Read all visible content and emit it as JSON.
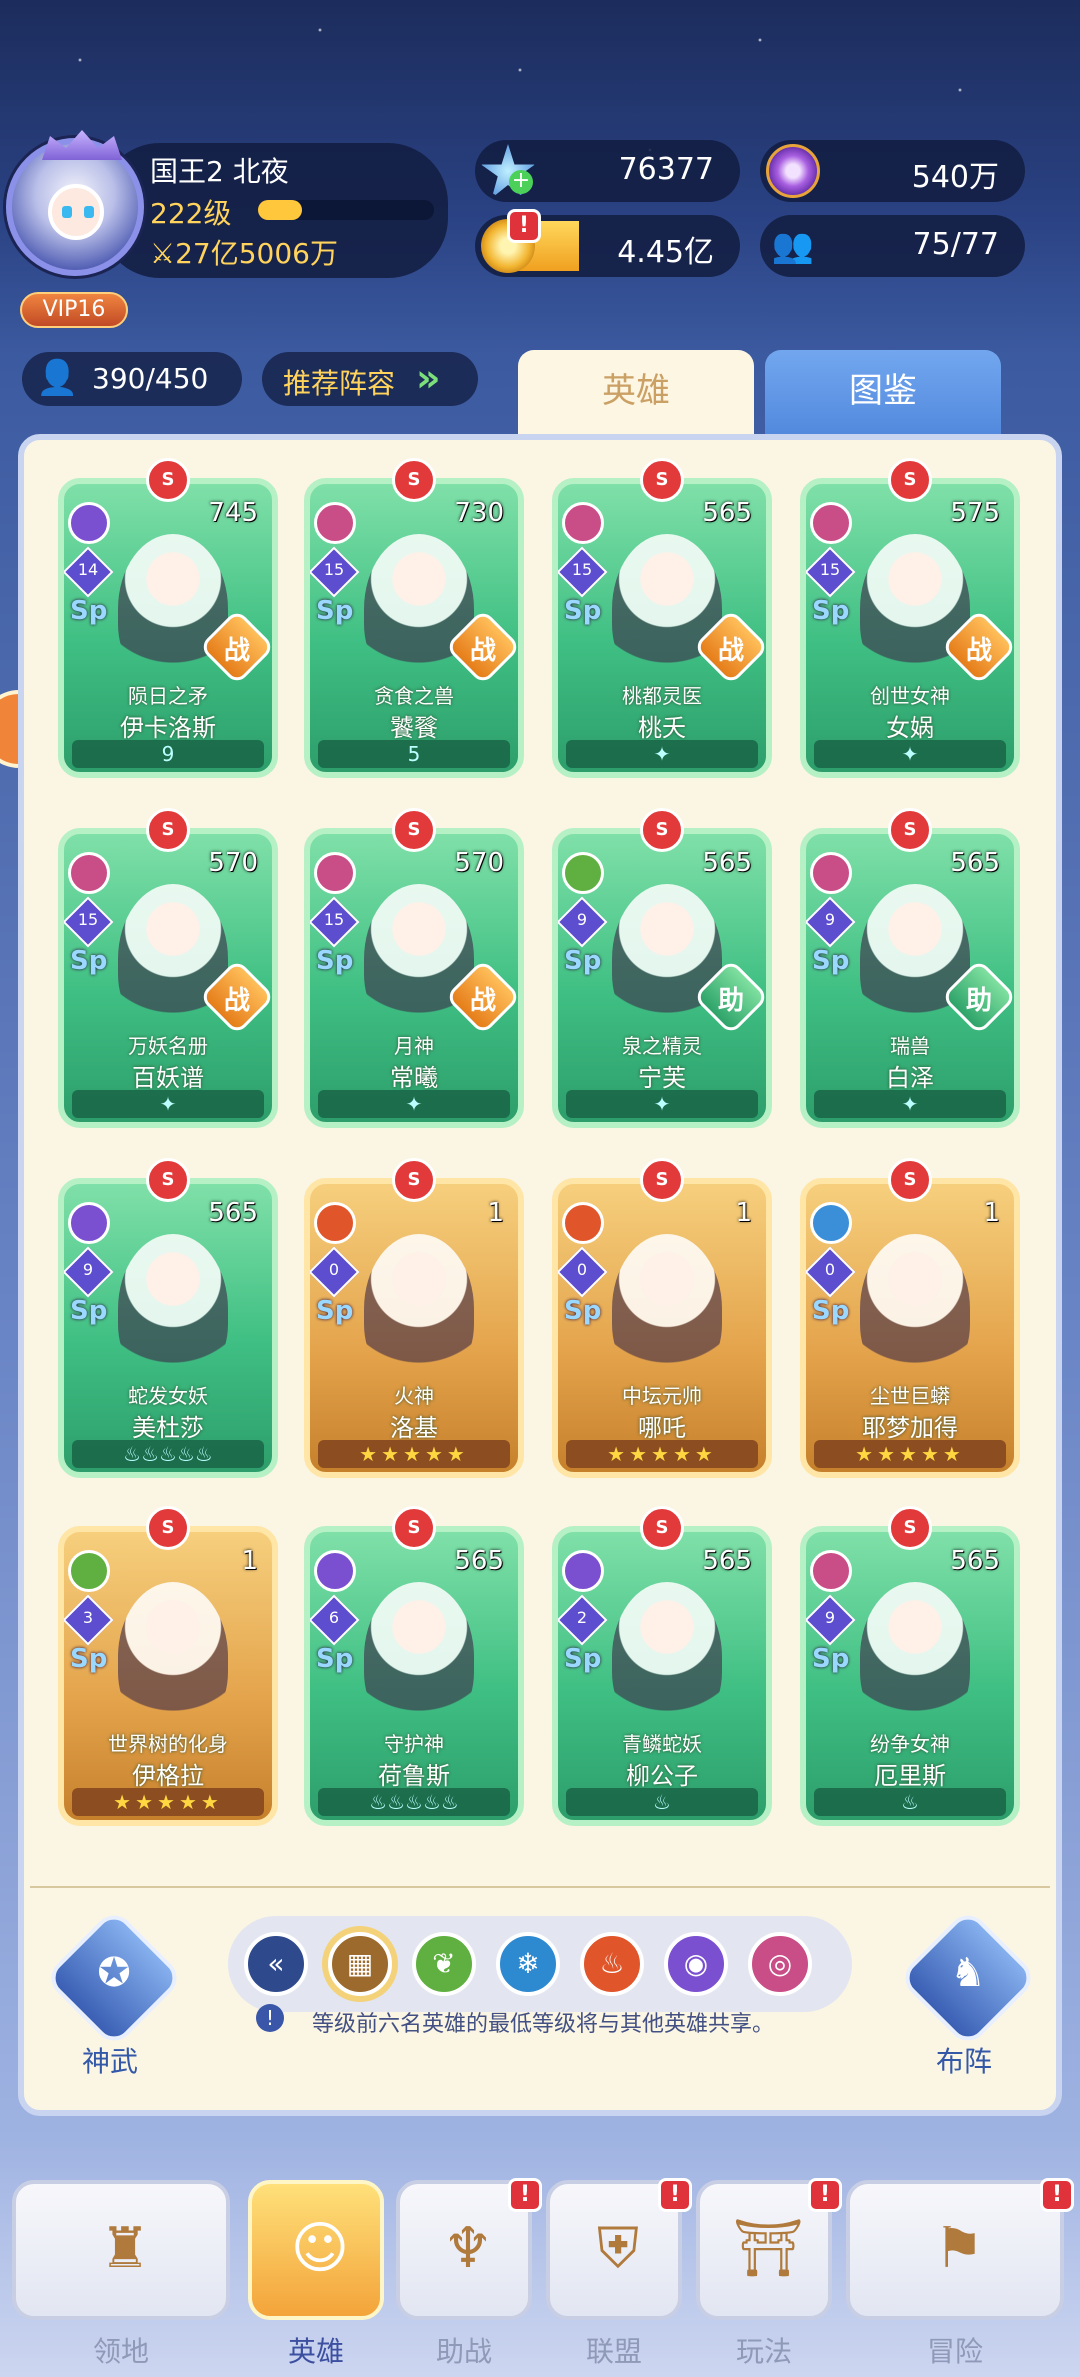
{
  "player": {
    "name": "国王2 北夜",
    "level": "222级",
    "level_progress": 0.25,
    "power": "27亿5006万",
    "vip": "VIP16"
  },
  "resources": {
    "crystal": "76377",
    "purple_coin": "540万",
    "gold": "4.45亿",
    "team_count": "75/77"
  },
  "roster": {
    "count": "390/450",
    "recommend_label": "推荐阵容"
  },
  "tabs": {
    "heroes": "英雄",
    "codex": "图鉴"
  },
  "cards": [
    {
      "title": "陨日之矛",
      "name": "伊卡洛斯",
      "power": "745",
      "role": "战",
      "star": "14",
      "foot": "9",
      "theme": "green",
      "elem": "#7a4fd0"
    },
    {
      "title": "贪食之兽",
      "name": "饕餮",
      "power": "730",
      "role": "战",
      "star": "15",
      "foot": "5",
      "theme": "green",
      "elem": "#c94d86"
    },
    {
      "title": "桃都灵医",
      "name": "桃夭",
      "power": "565",
      "role": "战",
      "star": "15",
      "foot": "✦",
      "theme": "green",
      "elem": "#c94d86"
    },
    {
      "title": "创世女神",
      "name": "女娲",
      "power": "575",
      "role": "战",
      "star": "15",
      "foot": "✦",
      "theme": "green",
      "elem": "#c94d86"
    },
    {
      "title": "万妖名册",
      "name": "百妖谱",
      "power": "570",
      "role": "战",
      "star": "15",
      "foot": "✦",
      "theme": "green",
      "elem": "#c94d86"
    },
    {
      "title": "月神",
      "name": "常曦",
      "power": "570",
      "role": "战",
      "star": "15",
      "foot": "✦",
      "theme": "green",
      "elem": "#c94d86"
    },
    {
      "title": "泉之精灵",
      "name": "宁芙",
      "power": "565",
      "role": "助",
      "star": "9",
      "foot": "✦",
      "theme": "green",
      "elem": "#5fb040"
    },
    {
      "title": "瑞兽",
      "name": "白泽",
      "power": "565",
      "role": "助",
      "star": "9",
      "foot": "✦",
      "theme": "green",
      "elem": "#c94d86"
    },
    {
      "title": "蛇发女妖",
      "name": "美杜莎",
      "power": "565",
      "role": "",
      "star": "9",
      "foot": "♨♨♨♨♨",
      "theme": "green",
      "elem": "#7a4fd0"
    },
    {
      "title": "火神",
      "name": "洛基",
      "power": "1",
      "role": "",
      "star": "0",
      "foot": "★★★★★",
      "theme": "gold",
      "elem": "#e0552a"
    },
    {
      "title": "中坛元帅",
      "name": "哪吒",
      "power": "1",
      "role": "",
      "star": "0",
      "foot": "★★★★★",
      "theme": "gold",
      "elem": "#e0552a"
    },
    {
      "title": "尘世巨蟒",
      "name": "耶梦加得",
      "power": "1",
      "role": "",
      "star": "0",
      "foot": "★★★★★",
      "theme": "gold",
      "elem": "#3a8fd8"
    },
    {
      "title": "世界树的化身",
      "name": "伊格拉",
      "power": "1",
      "role": "",
      "star": "3",
      "foot": "★★★★★",
      "theme": "gold",
      "elem": "#5fb040"
    },
    {
      "title": "守护神",
      "name": "荷鲁斯",
      "power": "565",
      "role": "",
      "star": "6",
      "foot": "♨♨♨♨♨",
      "theme": "green",
      "elem": "#7a4fd0"
    },
    {
      "title": "青鳞蛇妖",
      "name": "柳公子",
      "power": "565",
      "role": "",
      "star": "2",
      "foot": "♨",
      "theme": "green",
      "elem": "#7a4fd0"
    },
    {
      "title": "纷争女神",
      "name": "厄里斯",
      "power": "565",
      "role": "",
      "star": "9",
      "foot": "♨",
      "theme": "green",
      "elem": "#c94d86"
    }
  ],
  "actions": {
    "weapon_label": "神武",
    "formation_label": "布阵"
  },
  "filters": [
    {
      "icon": "«",
      "color": "#2f4a8c"
    },
    {
      "icon": "▦",
      "color": "#9b6a2c"
    },
    {
      "icon": "❦",
      "color": "#5fb040"
    },
    {
      "icon": "❄",
      "color": "#2e8ad0"
    },
    {
      "icon": "♨",
      "color": "#e0552a"
    },
    {
      "icon": "◉",
      "color": "#7a4fd0"
    },
    {
      "icon": "◎",
      "color": "#c94d86"
    }
  ],
  "info_text": "等级前六名英雄的最低等级将与其他英雄共享。",
  "nav": [
    {
      "label": "领地",
      "icon": "♜",
      "active": false,
      "alert": false
    },
    {
      "label": "英雄",
      "icon": "☺",
      "active": true,
      "alert": false
    },
    {
      "label": "助战",
      "icon": "♆",
      "active": false,
      "alert": true
    },
    {
      "label": "联盟",
      "icon": "⛨",
      "active": false,
      "alert": true
    },
    {
      "label": "玩法",
      "icon": "⛩",
      "active": false,
      "alert": true
    },
    {
      "label": "冒险",
      "icon": "⚑",
      "active": false,
      "alert": true
    }
  ]
}
